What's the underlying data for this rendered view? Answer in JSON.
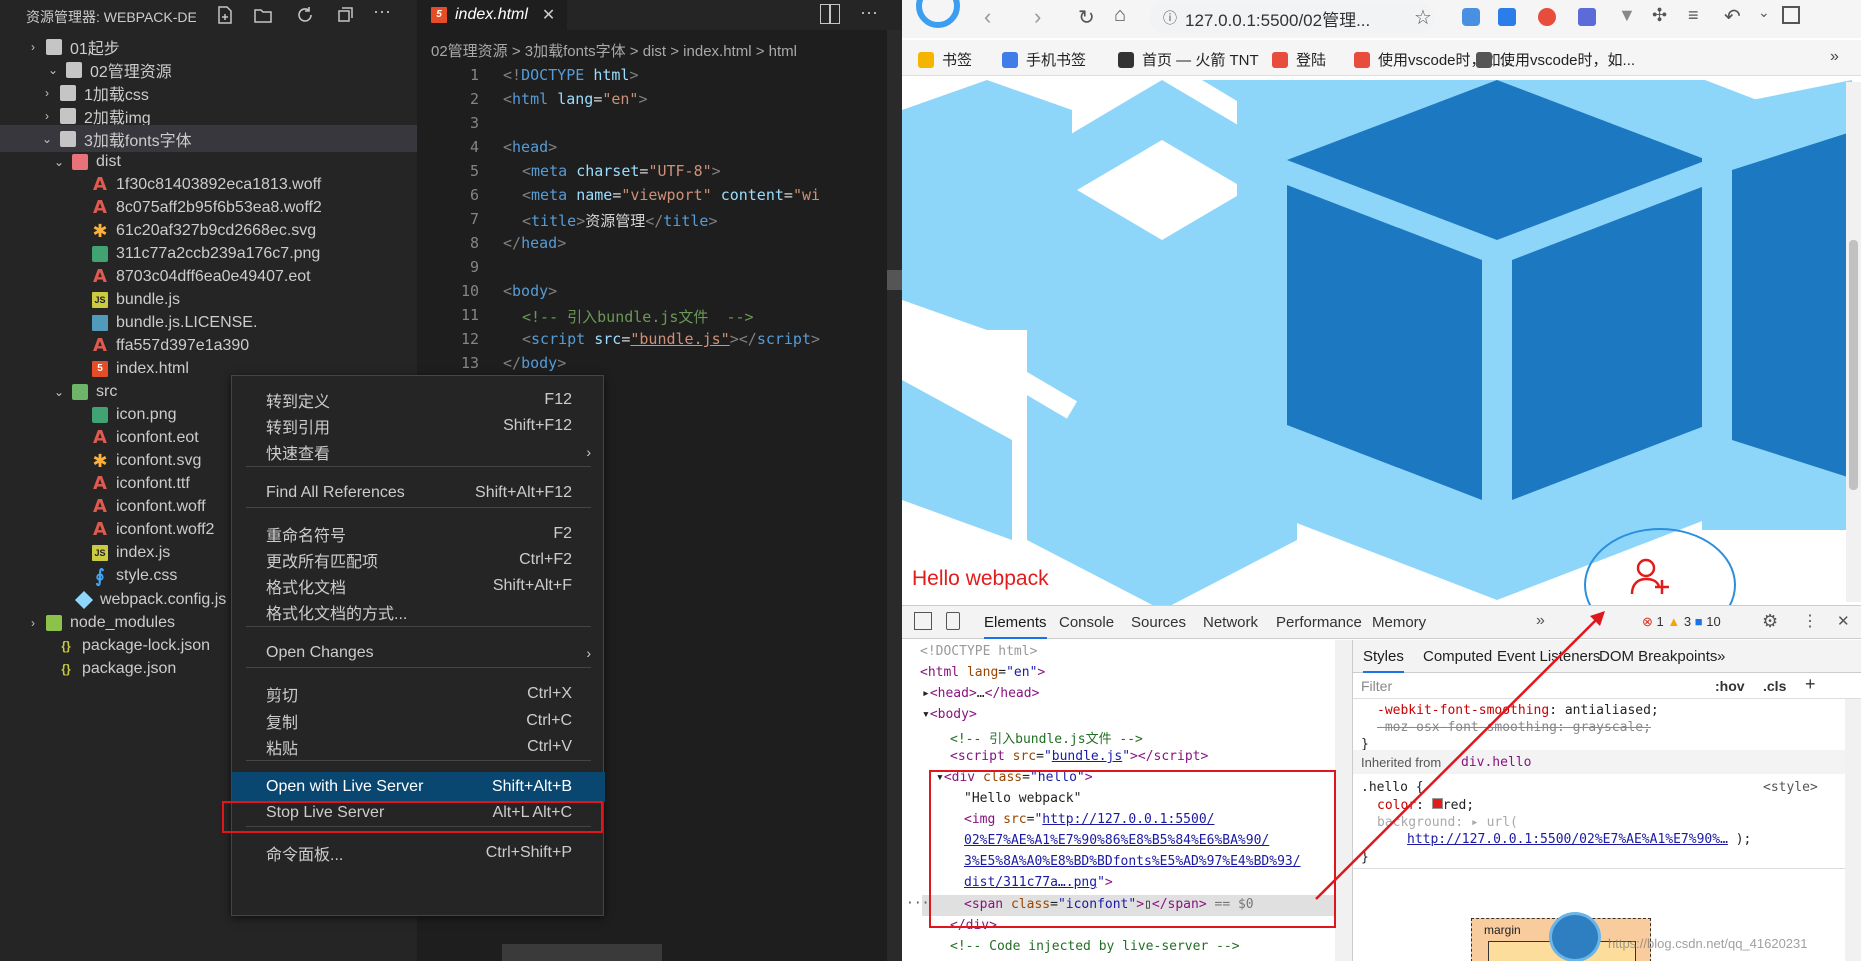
{
  "explorer": {
    "title": "资源管理器: WEBPACK-DE...",
    "items": [
      {
        "label": "01起步",
        "kind": "folder",
        "open": false
      },
      {
        "label": "02管理资源",
        "kind": "folder",
        "open": true
      },
      {
        "label": "1加载css",
        "kind": "folder",
        "open": false
      },
      {
        "label": "2加载img",
        "kind": "folder",
        "open": false
      },
      {
        "label": "3加载fonts字体",
        "kind": "folder",
        "open": true
      },
      {
        "label": "dist",
        "kind": "folder-red",
        "open": true
      },
      {
        "label": "1f30c81403892eca1813.woff",
        "kind": "font"
      },
      {
        "label": "8c075aff2b95f6b53ea8.woff2",
        "kind": "font"
      },
      {
        "label": "61c20af327b9cd2668ec.svg",
        "kind": "svg"
      },
      {
        "label": "311c77a2ccb239a176c7.png",
        "kind": "png"
      },
      {
        "label": "8703c04dff6ea0e49407.eot",
        "kind": "font"
      },
      {
        "label": "bundle.js",
        "kind": "js"
      },
      {
        "label": "bundle.js.LICENSE.",
        "kind": "doc"
      },
      {
        "label": "ffa557d397e1a390",
        "kind": "font"
      },
      {
        "label": "index.html",
        "kind": "html"
      },
      {
        "label": "src",
        "kind": "folder-src",
        "open": true
      },
      {
        "label": "icon.png",
        "kind": "png"
      },
      {
        "label": "iconfont.eot",
        "kind": "font"
      },
      {
        "label": "iconfont.svg",
        "kind": "svg"
      },
      {
        "label": "iconfont.ttf",
        "kind": "font"
      },
      {
        "label": "iconfont.woff",
        "kind": "font"
      },
      {
        "label": "iconfont.woff2",
        "kind": "font"
      },
      {
        "label": "index.js",
        "kind": "js"
      },
      {
        "label": "style.css",
        "kind": "css"
      },
      {
        "label": "webpack.config.js",
        "kind": "wp"
      },
      {
        "label": "node_modules",
        "kind": "folder-nm",
        "open": false
      },
      {
        "label": "package-lock.json",
        "kind": "json"
      },
      {
        "label": "package.json",
        "kind": "json"
      }
    ]
  },
  "editor": {
    "tab": "index.html",
    "breadcrumb": "02管理资源 > 3加载fonts字体 > dist > index.html > html",
    "lines": [
      "1",
      "2",
      "3",
      "4",
      "5",
      "6",
      "7",
      "8",
      "9",
      "10",
      "11",
      "12",
      "13"
    ]
  },
  "context_menu": {
    "items": [
      {
        "label": "转到定义",
        "key": "F12"
      },
      {
        "label": "转到引用",
        "key": "Shift+F12"
      },
      {
        "label": "快速查看",
        "key": "›"
      },
      {
        "label": "Find All References",
        "key": "Shift+Alt+F12"
      },
      {
        "label": "重命名符号",
        "key": "F2"
      },
      {
        "label": "更改所有匹配项",
        "key": "Ctrl+F2"
      },
      {
        "label": "格式化文档",
        "key": "Shift+Alt+F"
      },
      {
        "label": "格式化文档的方式...",
        "key": ""
      },
      {
        "label": "Open Changes",
        "key": "›"
      },
      {
        "label": "剪切",
        "key": "Ctrl+X"
      },
      {
        "label": "复制",
        "key": "Ctrl+C"
      },
      {
        "label": "粘贴",
        "key": "Ctrl+V"
      },
      {
        "label": "Open with Live Server",
        "key": "Shift+Alt+B"
      },
      {
        "label": "Stop Live Server",
        "key": "Alt+L Alt+C"
      },
      {
        "label": "命令面板...",
        "key": "Ctrl+Shift+P"
      }
    ]
  },
  "browser": {
    "url": "127.0.0.1:5500/02管理...",
    "bookmarks": [
      "书签",
      "手机书签",
      "首页 — 火箭 TNT",
      "登陆",
      "使用vscode时，如...",
      "使用vscode时，如..."
    ],
    "page_text": "Hello webpack",
    "colors": {
      "accent": "#e21b1b",
      "hex_light": "#8dd6f9",
      "hex_dark": "#1c78c0"
    }
  },
  "devtools": {
    "tabs": [
      "Elements",
      "Console",
      "Sources",
      "Network",
      "Performance",
      "Memory"
    ],
    "counts": {
      "errors": "1",
      "warnings": "3",
      "info": "10"
    },
    "style_tabs": [
      "Styles",
      "Computed",
      "Event Listeners",
      "DOM Breakpoints"
    ],
    "filter_placeholder": "Filter",
    "hov": ":hov",
    "cls": ".cls",
    "inherited": "Inherited from",
    "inherited_sel": "div.hello",
    "rule_sel": ".hello {",
    "rule_src": "<style>",
    "box_label": "margin",
    "watermark": "https://blog.csdn.net/qq_41620231"
  }
}
